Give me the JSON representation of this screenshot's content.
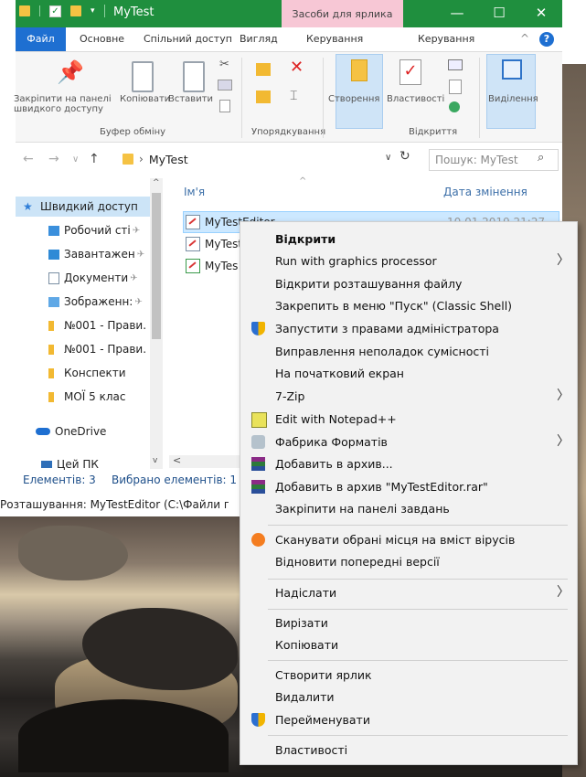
{
  "window": {
    "title": "MyTest",
    "context_tab": "Засоби для ярлика",
    "minimize": "—",
    "maximize": "☐",
    "close": "✕"
  },
  "ribbon_tabs": [
    {
      "label": "Файл"
    },
    {
      "label": "Основне"
    },
    {
      "label": "Спільний доступ"
    },
    {
      "label": "Вигляд"
    },
    {
      "label": "Керування"
    },
    {
      "label": "Керування"
    }
  ],
  "ribbon": {
    "pin_label": "Закріпити на панелі швидкого доступу",
    "copy_label": "Копіювати",
    "paste_label": "Вставити",
    "clipboard_group": "Буфер обміну",
    "organize_group": "Упорядкування",
    "create_label": "Створення",
    "properties_label": "Властивості",
    "open_group": "Відкриття",
    "select_label": "Виділення"
  },
  "address": {
    "path": "MyTest",
    "search_placeholder": "Пошук: MyTest"
  },
  "navpane": [
    {
      "label": "Швидкий доступ",
      "color": "#2f7ed8"
    },
    {
      "label": "Робочий сті",
      "color": "#3a8fdc",
      "pinned": true
    },
    {
      "label": "Завантажен",
      "color": "#2f8ad6",
      "pinned": true
    },
    {
      "label": "Документи",
      "color": "#7a8fa3",
      "pinned": true
    },
    {
      "label": "Зображенн:",
      "color": "#2f8ad6",
      "pinned": true
    },
    {
      "label": "№001 - Прави.",
      "color": "#f2b932"
    },
    {
      "label": "№001 - Прави.",
      "color": "#f2b932"
    },
    {
      "label": "Конспекти",
      "color": "#f2b932"
    },
    {
      "label": "МОЇ 5 клас",
      "color": "#f2b932"
    },
    {
      "label": "OneDrive",
      "color": "#1e6fd1"
    },
    {
      "label": "Цей ПК",
      "color": "#2f6fb8"
    }
  ],
  "filelist": {
    "col_name": "Ім'я",
    "col_date": "Дата змінення",
    "files": [
      {
        "name": "MyTestEditor",
        "date": "10.01.2019 21:27"
      },
      {
        "name": "MyTest"
      },
      {
        "name": "MyTes"
      }
    ]
  },
  "status": {
    "count": "Елементів: 3",
    "selected": "Вибрано елементів: 1",
    "location": "Розташування: MyTestEditor (C:\\Файли пр"
  },
  "context_menu": {
    "items": [
      {
        "label": "Відкрити",
        "bold": true
      },
      {
        "label": "Run with graphics processor",
        "submenu": true
      },
      {
        "label": "Відкрити розташування файлу"
      },
      {
        "label": "Закрепить в меню \"Пуск\" (Classic Shell)"
      },
      {
        "label": "Запустити з правами адміністратора",
        "icon": "shield"
      },
      {
        "label": "Виправлення неполадок сумісності"
      },
      {
        "label": "На початковий екран"
      },
      {
        "label": "7-Zip",
        "submenu": true
      },
      {
        "label": "Edit with Notepad++",
        "icon": "notepad"
      },
      {
        "label": "Фабрика Форматів",
        "icon": "factory",
        "submenu": true
      },
      {
        "label": "Добавить в архив...",
        "icon": "winrar"
      },
      {
        "label": "Добавить в архив \"MyTestEditor.rar\"",
        "icon": "winrar"
      },
      {
        "label": "Закріпити на панелі завдань"
      },
      {
        "label": "Сканувати обрані місця на вміст вірусів",
        "icon": "avast"
      },
      {
        "label": "Відновити попередні версії"
      },
      {
        "label": "Надіслати",
        "submenu": true
      },
      {
        "label": "Вирізати"
      },
      {
        "label": "Копіювати"
      },
      {
        "label": "Створити ярлик"
      },
      {
        "label": "Видалити"
      },
      {
        "label": "Перейменувати",
        "icon": "shield"
      },
      {
        "label": "Властивості"
      }
    ]
  },
  "colors": {
    "titlebar": "#1f8f3e",
    "context_tab": "#f7c7d5",
    "file_tab": "#1e6fd1",
    "selection": "#cce8ff"
  }
}
